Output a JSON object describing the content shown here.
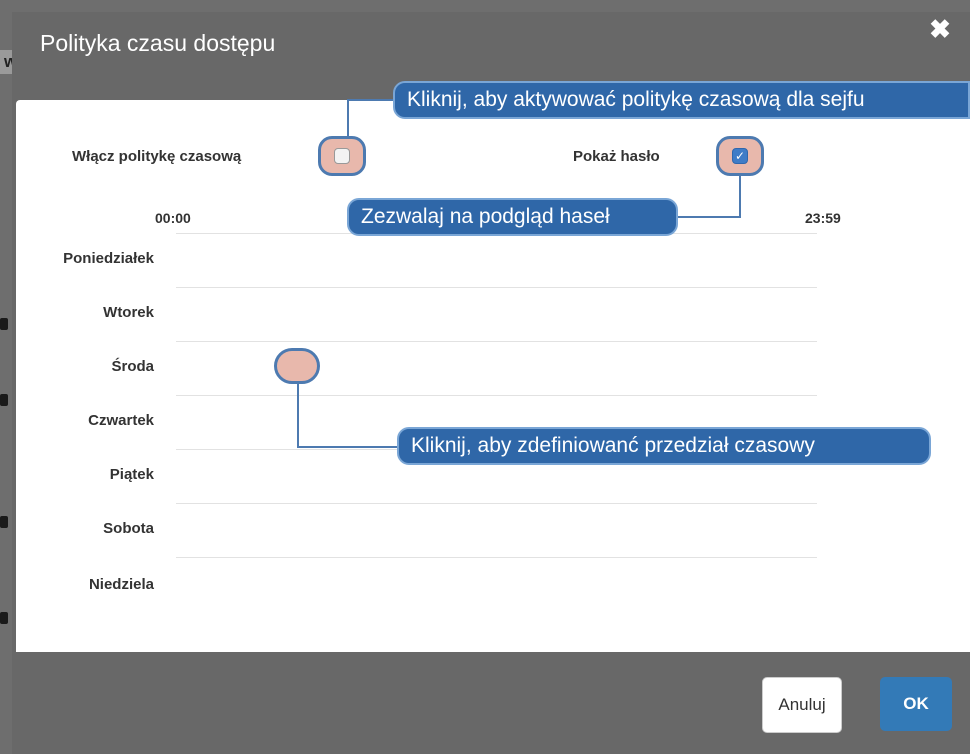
{
  "background": {
    "fragment": "wnika"
  },
  "modal": {
    "title": "Polityka czasu dostępu",
    "close_glyph": "✖",
    "enable_label": "Włącz politykę czasową",
    "show_password_label": "Pokaż hasło",
    "time_start": "00:00",
    "time_end": "23:59",
    "days": [
      "Poniedziałek",
      "Wtorek",
      "Środa",
      "Czwartek",
      "Piątek",
      "Sobota",
      "Niedziela"
    ],
    "enable_checked": false,
    "show_password_checked": true,
    "cancel_label": "Anuluj",
    "ok_label": "OK"
  },
  "tooltips": {
    "enable": "Kliknij, aby aktywować politykę czasową dla sejfu",
    "password": "Zezwalaj na podgląd haseł",
    "range": "Kliknij, aby zdefiniowanć przedział czasowy"
  },
  "colors": {
    "accent": "#337ab7",
    "callout": "#2f67a8",
    "highlight": "#e8b8ac",
    "overlay": "#686868"
  }
}
